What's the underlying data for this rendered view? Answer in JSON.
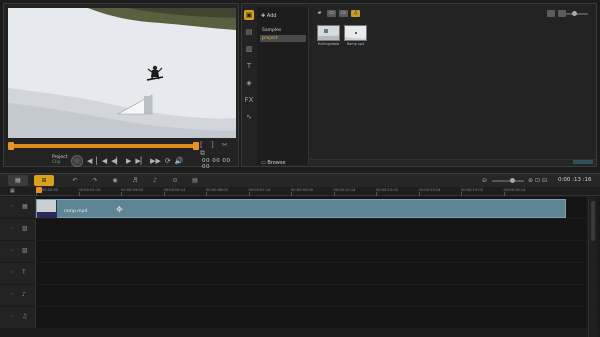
{
  "player": {
    "mode_project": "Project",
    "mode_clip": "Clip",
    "timecode": "00 00 00 00",
    "trim_icons": "[ ] ✂ ⧉",
    "transport": [
      "◀",
      "▏◀",
      "◀▏",
      "▶",
      "▶▏",
      "▶▶",
      "⟳",
      "🔊"
    ],
    "scrub_progress": 0.99
  },
  "library": {
    "add_label": "Add",
    "folders": [
      "Samples",
      "project"
    ],
    "browse_label": "Browse",
    "media": [
      {
        "name": "Hollingsdale",
        "tone": "light"
      },
      {
        "name": "Ramp sp4",
        "tone": "snow"
      }
    ],
    "tool_icons": [
      "media-icon",
      "instant-project-icon",
      "transition-icon",
      "title-icon",
      "graphic-icon",
      "fx-icon",
      "path-icon"
    ]
  },
  "timeline": {
    "tabs": [
      "▤",
      "⊞"
    ],
    "duration": "0:00 :13 :16",
    "ruler_labels": [
      "00:00:00:00",
      "00:00:01:14",
      "00:00:03:00",
      "00:00:04:14",
      "00:00:06:00",
      "00:00:07:14",
      "00:00:09:00",
      "00:00:10:14",
      "00:00:12:00",
      "00:00:13:14",
      "00:00:15:00",
      "00:00:16:14"
    ],
    "clip_label": "ramp.mp4",
    "tracks": [
      {
        "name": "video-track",
        "icon": "▦"
      },
      {
        "name": "overlay-track",
        "icon": "▧"
      },
      {
        "name": "overlay-track-2",
        "icon": "▧"
      },
      {
        "name": "title-track",
        "icon": "T"
      },
      {
        "name": "voice-track",
        "icon": "♪"
      },
      {
        "name": "music-track",
        "icon": "♫"
      }
    ]
  },
  "colors": {
    "accent": "#e8912a",
    "clip": "#5e8596",
    "panel": "#232323"
  }
}
